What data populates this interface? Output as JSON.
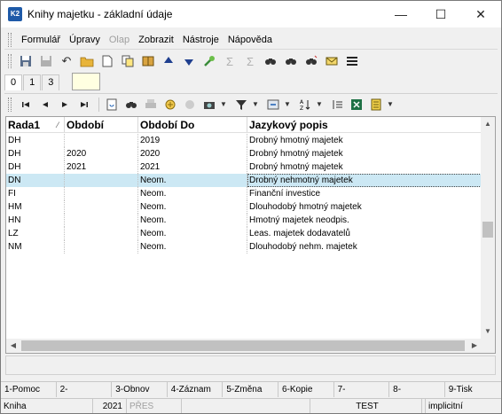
{
  "window": {
    "title": "Knihy majetku - základní údaje",
    "app_icon_text": "K2",
    "minimize": "—",
    "maximize": "☐",
    "close": "✕"
  },
  "menu": [
    {
      "label": "Formulář",
      "enabled": true
    },
    {
      "label": "Úpravy",
      "enabled": true
    },
    {
      "label": "Olap",
      "enabled": false
    },
    {
      "label": "Zobrazit",
      "enabled": true
    },
    {
      "label": "Nástroje",
      "enabled": true
    },
    {
      "label": "Nápověda",
      "enabled": true
    }
  ],
  "toolbar_icons": [
    "save-icon",
    "save-all-icon",
    "undo-icon",
    "open-folder-icon",
    "new-document-icon",
    "copy-icon",
    "book-icon",
    "arrow-up-icon",
    "arrow-down-icon",
    "tool-icon",
    "sum-icon",
    "sum-filter-icon",
    "find-icon",
    "find-next-icon",
    "find-replace-icon",
    "mail-icon",
    "menu-icon"
  ],
  "tabs": [
    {
      "label": "0",
      "active": true
    },
    {
      "label": "1",
      "active": false
    },
    {
      "label": "3",
      "active": false
    }
  ],
  "inner_toolbar_icons": [
    "first-record-icon",
    "previous-record-icon",
    "next-record-icon",
    "last-record-icon",
    "refresh-icon",
    "binoculars-icon",
    "print-icon",
    "add-icon",
    "add-alt-icon",
    "camera-icon",
    "filter-icon",
    "export-icon",
    "sort-icon",
    "columns-icon",
    "excel-icon",
    "notes-icon"
  ],
  "grid": {
    "columns": [
      "Rada1",
      "Období",
      "Období Do",
      "Jazykový popis"
    ],
    "sort_indicator": "⁄",
    "rows": [
      {
        "rada": "DH",
        "obdobi": "",
        "obdobi_do": "2019",
        "popis": "Drobný hmotný majetek",
        "selected": false
      },
      {
        "rada": "DH",
        "obdobi": "2020",
        "obdobi_do": "2020",
        "popis": "Drobný hmotný majetek",
        "selected": false
      },
      {
        "rada": "DH",
        "obdobi": "2021",
        "obdobi_do": "2021",
        "popis": "Drobný hmotný majetek",
        "selected": false
      },
      {
        "rada": "DN",
        "obdobi": "",
        "obdobi_do": "Neom.",
        "popis": "Drobný nehmotný majetek",
        "selected": true
      },
      {
        "rada": "FI",
        "obdobi": "",
        "obdobi_do": "Neom.",
        "popis": "Finanční investice",
        "selected": false
      },
      {
        "rada": "HM",
        "obdobi": "",
        "obdobi_do": "Neom.",
        "popis": "Dlouhodobý hmotný majetek",
        "selected": false
      },
      {
        "rada": "HN",
        "obdobi": "",
        "obdobi_do": "Neom.",
        "popis": "Hmotný majetek neodpis.",
        "selected": false
      },
      {
        "rada": "LZ",
        "obdobi": "",
        "obdobi_do": "Neom.",
        "popis": "Leas. majetek dodavatelů",
        "selected": false
      },
      {
        "rada": "NM",
        "obdobi": "",
        "obdobi_do": "Neom.",
        "popis": "Dlouhodobý nehm. majetek",
        "selected": false
      }
    ]
  },
  "function_keys": [
    "1-Pomoc",
    "2-",
    "3-Obnov",
    "4-Záznam",
    "5-Změna",
    "6-Kopie",
    "7-",
    "8-",
    "9-Tisk"
  ],
  "status": {
    "module": "Kniha",
    "year": "2021",
    "mode": "PŘES",
    "empty1": "",
    "company": "TEST",
    "empty2": "",
    "setting": "implicitní"
  }
}
